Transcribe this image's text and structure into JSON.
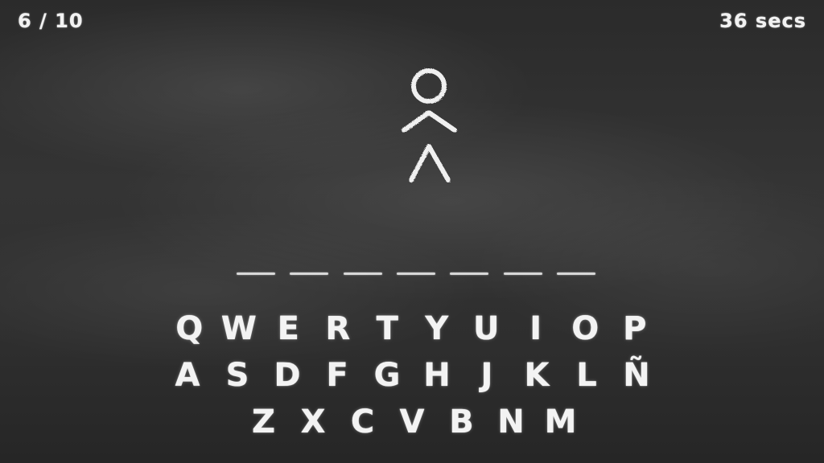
{
  "hud": {
    "progress": "6 / 10",
    "timer": "36 secs"
  },
  "word": {
    "blank_count": 7
  },
  "keyboard": {
    "rows": [
      [
        "Q",
        "W",
        "E",
        "R",
        "T",
        "Y",
        "U",
        "I",
        "O",
        "P"
      ],
      [
        "A",
        "S",
        "D",
        "F",
        "G",
        "H",
        "J",
        "K",
        "L",
        "Ñ"
      ],
      [
        "Z",
        "X",
        "C",
        "V",
        "B",
        "N",
        "M"
      ]
    ]
  },
  "colors": {
    "chalk": "#f2f2f2",
    "board": "#2f2f2f"
  }
}
